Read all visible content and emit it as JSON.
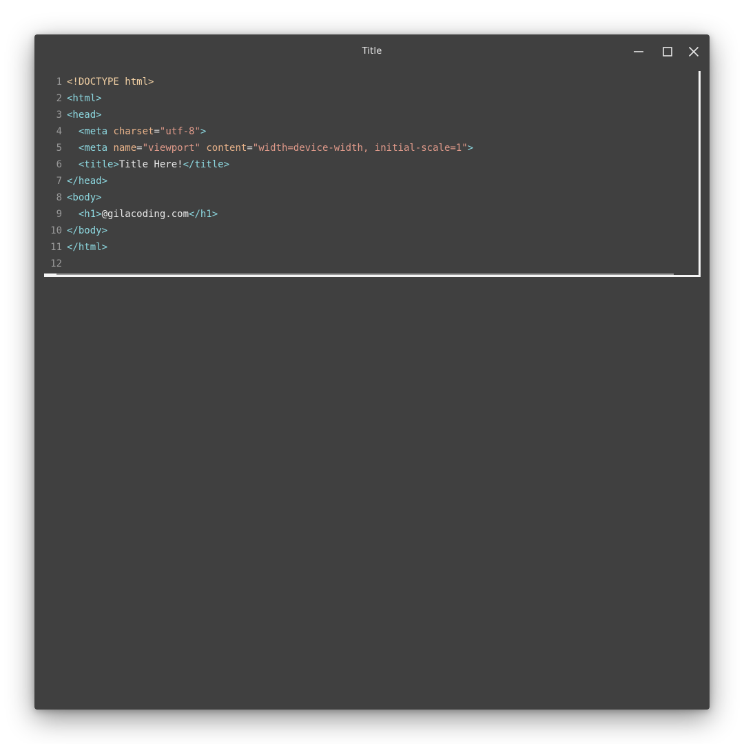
{
  "window": {
    "title": "Title",
    "controls": {
      "minimize_icon": "minimize-icon",
      "maximize_icon": "maximize-icon",
      "close_icon": "close-icon"
    }
  },
  "colors": {
    "window_bg": "#404040",
    "tag": "#8dd8e0",
    "attribute": "#e9b38a",
    "string": "#e09a8a",
    "doctype": "#f2d0a4",
    "text": "#e8e8e8",
    "line_number": "#9a9a9a"
  },
  "editor": {
    "lines": [
      {
        "num": "1",
        "tokens": [
          {
            "t": "<!DOCTYPE html>",
            "k": "doctype"
          }
        ]
      },
      {
        "num": "2",
        "tokens": [
          {
            "t": "<html>",
            "k": "tag"
          }
        ]
      },
      {
        "num": "3",
        "tokens": [
          {
            "t": "<head>",
            "k": "tag"
          }
        ]
      },
      {
        "num": "4",
        "tokens": [
          {
            "t": "  ",
            "k": "text"
          },
          {
            "t": "<meta",
            "k": "tag"
          },
          {
            "t": " ",
            "k": "text"
          },
          {
            "t": "charset",
            "k": "attr"
          },
          {
            "t": "=",
            "k": "eq"
          },
          {
            "t": "\"utf-8\"",
            "k": "str"
          },
          {
            "t": ">",
            "k": "tag"
          }
        ]
      },
      {
        "num": "5",
        "tokens": [
          {
            "t": "  ",
            "k": "text"
          },
          {
            "t": "<meta",
            "k": "tag"
          },
          {
            "t": " ",
            "k": "text"
          },
          {
            "t": "name",
            "k": "attr"
          },
          {
            "t": "=",
            "k": "eq"
          },
          {
            "t": "\"viewport\"",
            "k": "str"
          },
          {
            "t": " ",
            "k": "text"
          },
          {
            "t": "content",
            "k": "attr"
          },
          {
            "t": "=",
            "k": "eq"
          },
          {
            "t": "\"width=device-width, initial-scale=1\"",
            "k": "str"
          },
          {
            "t": ">",
            "k": "tag"
          }
        ]
      },
      {
        "num": "6",
        "tokens": [
          {
            "t": "  ",
            "k": "text"
          },
          {
            "t": "<title>",
            "k": "tag"
          },
          {
            "t": "Title Here!",
            "k": "text"
          },
          {
            "t": "</title>",
            "k": "tag"
          }
        ]
      },
      {
        "num": "7",
        "tokens": [
          {
            "t": "</head>",
            "k": "tag"
          }
        ]
      },
      {
        "num": "8",
        "tokens": [
          {
            "t": "<body>",
            "k": "tag"
          }
        ]
      },
      {
        "num": "9",
        "tokens": [
          {
            "t": "  ",
            "k": "text"
          },
          {
            "t": "<h1>",
            "k": "tag"
          },
          {
            "t": "@gilacoding.com",
            "k": "text"
          },
          {
            "t": "</h1>",
            "k": "tag"
          }
        ]
      },
      {
        "num": "10",
        "tokens": [
          {
            "t": "</body>",
            "k": "tag"
          }
        ]
      },
      {
        "num": "11",
        "tokens": [
          {
            "t": "</html>",
            "k": "tag"
          }
        ]
      },
      {
        "num": "12",
        "tokens": []
      }
    ]
  }
}
